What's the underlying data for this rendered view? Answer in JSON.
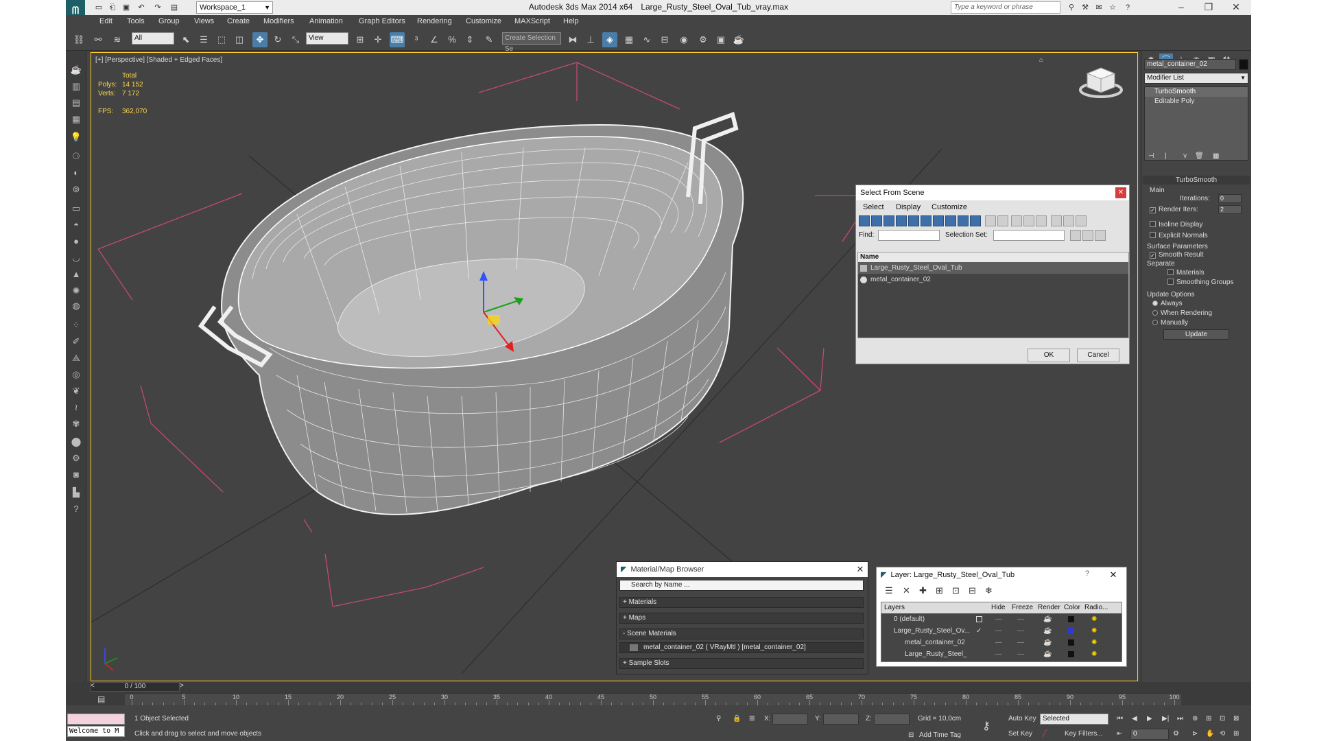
{
  "window": {
    "title_app": "Autodesk 3ds Max  2014 x64",
    "title_file": "Large_Rusty_Steel_Oval_Tub_vray.max",
    "workspace": "Workspace_1",
    "search_placeholder": "Type a keyword or phrase"
  },
  "menu": [
    "Edit",
    "Tools",
    "Group",
    "Views",
    "Create",
    "Modifiers",
    "Animation",
    "Graph Editors",
    "Rendering",
    "Customize",
    "MAXScript",
    "Help"
  ],
  "toolbar": {
    "selection_filter": "All",
    "ref_coord": "View",
    "named_selection": "Create Selection Se"
  },
  "viewport": {
    "label": "[+] [Perspective] [Shaded + Edged Faces]",
    "stats": {
      "total_label": "Total",
      "polys_label": "Polys:",
      "polys_value": "14 152",
      "verts_label": "Verts:",
      "verts_value": "7 172",
      "fps_label": "FPS:",
      "fps_value": "362,070"
    }
  },
  "select_from_scene": {
    "title": "Select From Scene",
    "menu": [
      "Select",
      "Display",
      "Customize"
    ],
    "find_label": "Find:",
    "selection_set_label": "Selection Set:",
    "column_name": "Name",
    "items": [
      "Large_Rusty_Steel_Oval_Tub",
      "metal_container_02"
    ],
    "ok": "OK",
    "cancel": "Cancel"
  },
  "material_browser": {
    "title": "Material/Map Browser",
    "search_placeholder": "Search by Name ...",
    "groups": [
      "+ Materials",
      "+ Maps",
      "- Scene Materials"
    ],
    "scene_material": "metal_container_02  ( VRayMtl ) [metal_container_02]",
    "sample_slots": "+ Sample Slots"
  },
  "layer_explorer": {
    "title": "Layer: Large_Rusty_Steel_Oval_Tub",
    "help": "?",
    "columns": [
      "Layers",
      "Hide",
      "Freeze",
      "Render",
      "Color",
      "Radio..."
    ],
    "rows": [
      {
        "name": "0 (default)",
        "color": "#111111"
      },
      {
        "name": "Large_Rusty_Steel_Ov...",
        "color": "#2d3bd6"
      },
      {
        "name": "metal_container_02",
        "color": "#111111"
      },
      {
        "name": "Large_Rusty_Steel_",
        "color": "#111111"
      }
    ]
  },
  "command_panel": {
    "object_name": "metal_container_02",
    "modifier_list": "Modifier List",
    "stack": [
      "TurboSmooth",
      "Editable Poly"
    ],
    "rollout_title": "TurboSmooth",
    "main": "Main",
    "iterations_label": "Iterations:",
    "iterations_value": "0",
    "render_iters_label": "Render Iters:",
    "render_iters_value": "2",
    "isoline": "Isoline Display",
    "explicit_normals": "Explicit Normals",
    "surface_params": "Surface Parameters",
    "smooth_result": "Smooth Result",
    "separate": "Separate",
    "materials": "Materials",
    "smoothing_groups": "Smoothing Groups",
    "update_options": "Update Options",
    "always": "Always",
    "when_rendering": "When Rendering",
    "manually": "Manually",
    "update_button": "Update"
  },
  "timeline": {
    "frame": "0 / 100",
    "ticks": [
      "0",
      "5",
      "10",
      "15",
      "20",
      "25",
      "30",
      "35",
      "40",
      "45",
      "50",
      "55",
      "60",
      "65",
      "70",
      "75",
      "80",
      "85",
      "90",
      "95",
      "100"
    ]
  },
  "status": {
    "maxscript": "Welcome to M",
    "selected": "1 Object Selected",
    "prompt": "Click and drag to select and move objects",
    "x_label": "X:",
    "y_label": "Y:",
    "z_label": "Z:",
    "grid": "Grid = 10,0cm",
    "add_time_tag": "Add Time Tag",
    "auto_key": "Auto Key",
    "set_key": "Set Key",
    "key_mode": "Selected",
    "key_filters": "Key Filters...",
    "frame_field": "0"
  },
  "colors": {
    "accent": "#4a7ea8",
    "viewport_border": "#ffcc2b",
    "stats_text": "#ffd84a"
  }
}
